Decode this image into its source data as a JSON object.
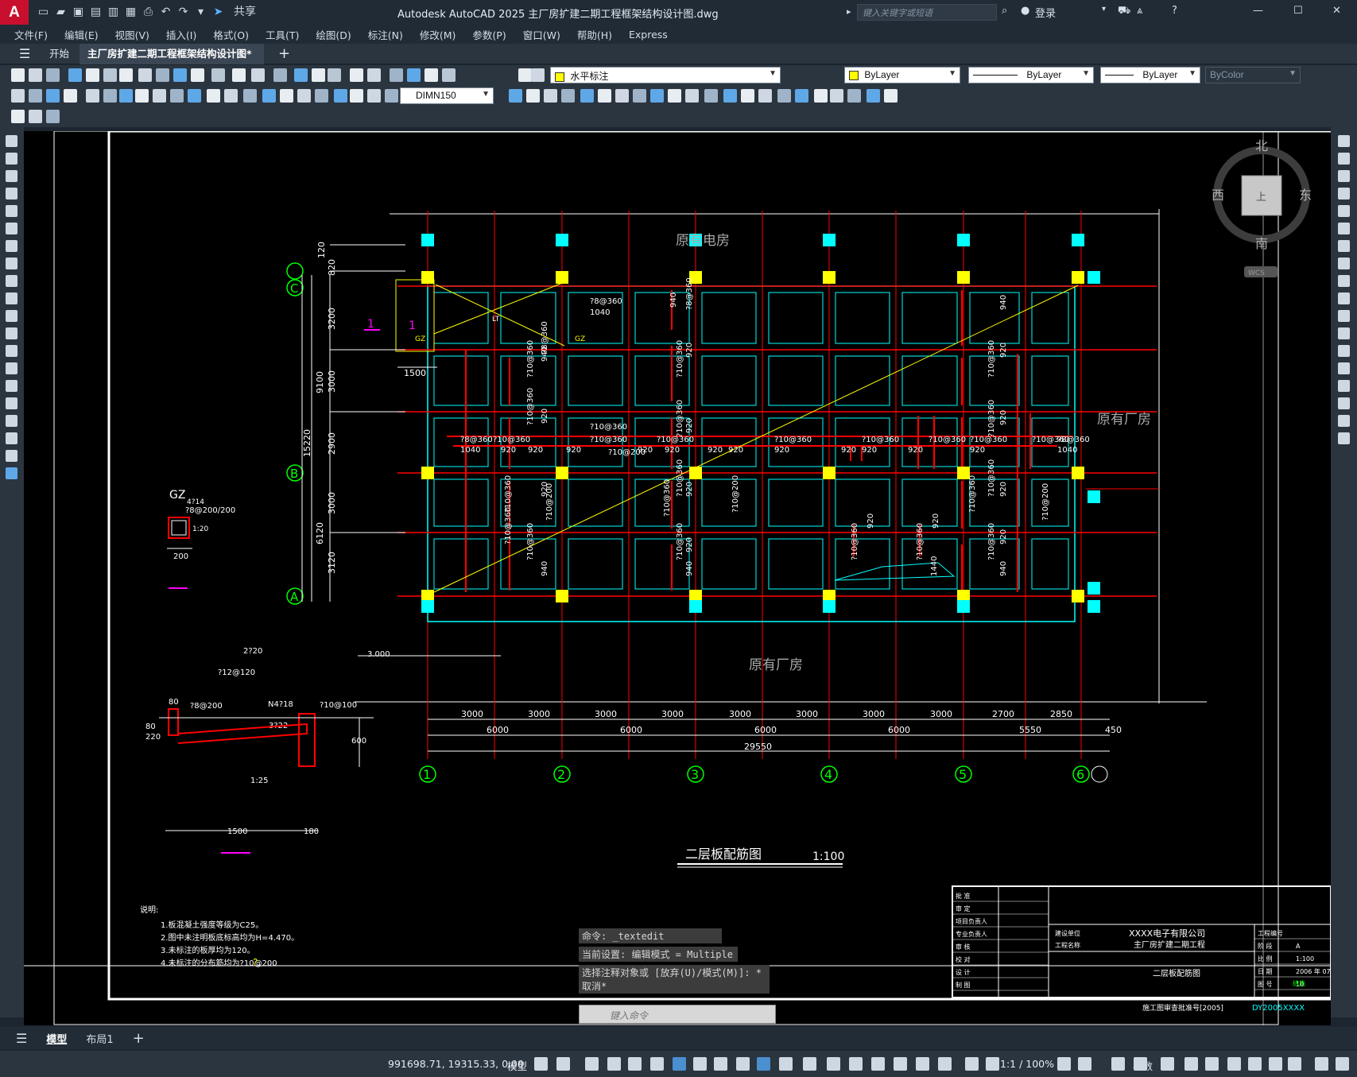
{
  "app": {
    "logo_letter": "A",
    "title": "Autodesk AutoCAD 2025    主厂房扩建二期工程框架结构设计图.dwg",
    "share_label": "共享",
    "search_placeholder": "键入关键字或短语",
    "login_label": "登录"
  },
  "menu": [
    "文件(F)",
    "编辑(E)",
    "视图(V)",
    "插入(I)",
    "格式(O)",
    "工具(T)",
    "绘图(D)",
    "标注(N)",
    "修改(M)",
    "参数(P)",
    "窗口(W)",
    "帮助(H)",
    "Express"
  ],
  "tabs": {
    "start": "开始",
    "document": "主厂房扩建二期工程框架结构设计图*",
    "add": "+"
  },
  "properties": {
    "layer": "水平标注",
    "color": "ByLayer",
    "linetype": "ByLayer",
    "lineweight": "ByLayer",
    "plotstyle": "ByColor",
    "dimstyle": "DIMN150"
  },
  "viewcube": {
    "north": "北",
    "south": "南",
    "east": "东",
    "west": "西",
    "center": "上",
    "wcs": "WCS"
  },
  "drawing": {
    "labels_top": "原有电房",
    "labels_bottom": "原有厂房",
    "labels_right": "原有厂房",
    "plan_title": "二层板配筋图",
    "plan_scale": "1:100",
    "axes_h": [
      "1",
      "2",
      "3",
      "4",
      "5",
      "6"
    ],
    "axes_v": [
      "C",
      "B",
      "A"
    ],
    "dims_bay": [
      "3000",
      "3000",
      "3000",
      "3000",
      "3000",
      "3000",
      "3000",
      "3000",
      "2700",
      "2850"
    ],
    "dims_span": [
      "6000",
      "6000",
      "6000",
      "6000",
      "5550",
      "450"
    ],
    "dims_total": "29550",
    "dims_left_small": [
      "820",
      "3200",
      "3000",
      "2900",
      "3000",
      "3120"
    ],
    "dims_left_mid": [
      "9100",
      "6120"
    ],
    "dims_left_total": "15220",
    "dim_1500": "1500",
    "dims_left_top": "120",
    "gz_title": "GZ",
    "gz_rebar1": "4?14",
    "gz_rebar2": "?8@200/200",
    "gz_rebar3": "1:20",
    "gz_width": "200",
    "section_labels": {
      "mark1": "1",
      "gz": "GZ",
      "lt": "LT",
      "d1": "2?20",
      "d2": "?12@120",
      "d3": "3.000",
      "d4": "80",
      "d5": "?8@200",
      "d6": "N4?18",
      "d7": "?10@100",
      "d8": "3?22",
      "d9": "600",
      "d10": "1:25",
      "d11": "1500",
      "d12": "180",
      "d13": "80",
      "d14": "220",
      "d15": "10"
    },
    "rebar": {
      "r1": "?8@360",
      "r2": "1040",
      "r3": "?10@360",
      "r4": "920",
      "r5": "940",
      "r6": "?10@200",
      "r7": "1440"
    },
    "notes_title": "说明:",
    "notes": [
      "1.板混凝土强度等级为C25。",
      "2.图中未注明板底标高均为H=4.470。",
      "3.未标注的板厚均为120。",
      "4.未标注的分布筋均为?10@200"
    ],
    "title_block": {
      "rows_left": [
        "批 准",
        "审 定",
        "项目负责人",
        "专业负责人",
        "审 核",
        "校 对",
        "设 计",
        "制 图"
      ],
      "unit_label": "建设单位",
      "project_label": "工程名称",
      "company": "XXXX电子有限公司",
      "project": "主厂房扩建二期工程",
      "drawing_name": "二层板配筋图",
      "right_labels": [
        "工程编号",
        "阶 段",
        "比 例",
        "日 期",
        "图 号"
      ],
      "right_values": [
        "",
        "A",
        "1:100",
        "2006 年 07",
        "10"
      ],
      "cert": "施工图审查批准号[2005]",
      "doc_no": "DY2005XXXX",
      "sub": "结施"
    }
  },
  "command": {
    "history": [
      "命令: _textedit",
      "当前设置: 编辑模式 = Multiple",
      "选择注释对象或 [放弃(U)/模式(M)]: *取消*"
    ],
    "placeholder": "键入命令"
  },
  "layouts": {
    "model": "模型",
    "layout1": "布局1"
  },
  "status": {
    "coords": "991698.71, 19315.33, 0.00",
    "model": "模型",
    "scale": "1:1 / 100%",
    "units": "小数"
  },
  "colors": {
    "cyan": "#00ffff",
    "red": "#ff0000",
    "yellow": "#ffff00",
    "green": "#00ff00",
    "magenta": "#ff00ff",
    "white": "#ffffff"
  }
}
